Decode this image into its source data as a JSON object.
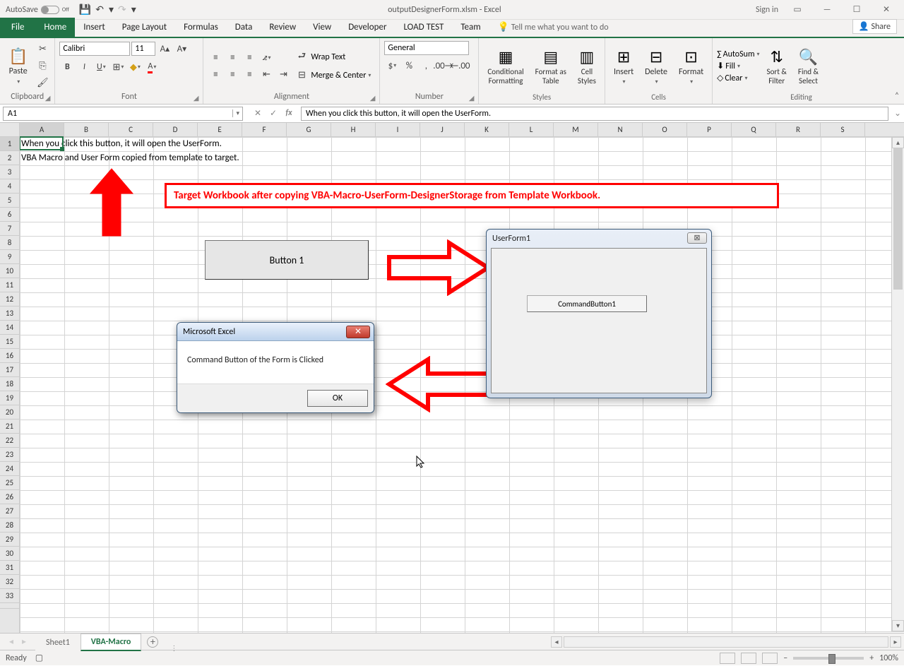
{
  "titlebar": {
    "autosave": "AutoSave",
    "off": "Off",
    "filename": "outputDesignerForm.xlsm - Excel",
    "signin": "Sign in"
  },
  "tabs": {
    "file": "File",
    "home": "Home",
    "insert": "Insert",
    "pagelayout": "Page Layout",
    "formulas": "Formulas",
    "data": "Data",
    "review": "Review",
    "view": "View",
    "developer": "Developer",
    "loadtest": "LOAD TEST",
    "team": "Team",
    "tellme": "Tell me what you want to do",
    "share": "Share"
  },
  "ribbon": {
    "clipboard": {
      "paste": "Paste",
      "label": "Clipboard"
    },
    "font": {
      "name": "Calibri",
      "size": "11",
      "label": "Font"
    },
    "alignment": {
      "wrap": "Wrap Text",
      "merge": "Merge & Center",
      "label": "Alignment"
    },
    "number": {
      "format": "General",
      "label": "Number"
    },
    "styles": {
      "cond": "Conditional\nFormatting",
      "table": "Format as\nTable",
      "cell": "Cell\nStyles",
      "label": "Styles"
    },
    "cells": {
      "insert": "Insert",
      "delete": "Delete",
      "format": "Format",
      "label": "Cells"
    },
    "editing": {
      "autosum": "AutoSum",
      "fill": "Fill",
      "clear": "Clear",
      "sort": "Sort &\nFilter",
      "find": "Find &\nSelect",
      "label": "Editing"
    }
  },
  "namebox": "A1",
  "formula": "When you click this button, it will open the UserForm.",
  "cell_a1": "When you click this button, it will open the UserForm.",
  "cell_a2": "VBA Macro and User Form copied from template to target.",
  "annotation": "Target Workbook after copying VBA-Macro-UserForm-DesignerStorage from Template Workbook.",
  "button1": "Button 1",
  "userform": {
    "title": "UserForm1",
    "cmd": "CommandButton1"
  },
  "msgbox": {
    "title": "Microsoft Excel",
    "body": "Command Button of the Form is Clicked",
    "ok": "OK"
  },
  "sheettabs": {
    "sheet1": "Sheet1",
    "vbamacro": "VBA-Macro"
  },
  "status": {
    "ready": "Ready",
    "zoom": "100%"
  },
  "columns": [
    "A",
    "B",
    "C",
    "D",
    "E",
    "F",
    "G",
    "H",
    "I",
    "J",
    "K",
    "L",
    "M",
    "N",
    "O",
    "P",
    "Q",
    "R",
    "S"
  ],
  "rows": [
    "1",
    "2",
    "3",
    "4",
    "5",
    "6",
    "7",
    "8",
    "9",
    "10",
    "11",
    "12",
    "13",
    "14",
    "15",
    "16",
    "17",
    "18",
    "19",
    "20",
    "21",
    "22",
    "23",
    "24",
    "25",
    "26",
    "27",
    "28",
    "29",
    "30",
    "31",
    "32",
    "33"
  ]
}
